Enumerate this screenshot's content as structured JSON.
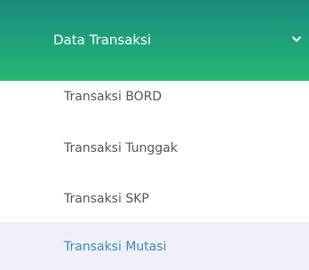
{
  "menu": {
    "header": {
      "label": "Data Transaksi",
      "icon": "chevron-down-icon",
      "colors": {
        "gradient_top": "#1a8a78",
        "gradient_bottom": "#27b86f",
        "text": "#ffffff"
      }
    },
    "items": [
      {
        "label": "Transaksi BORD",
        "active": false
      },
      {
        "label": "Transaksi Tunggak",
        "active": false
      },
      {
        "label": "Transaksi SKP",
        "active": false
      },
      {
        "label": "Transaksi Mutasi",
        "active": true
      }
    ],
    "colors": {
      "item_text": "#4f5562",
      "active_text": "#3a8fb7",
      "active_background": "#eeeff7"
    }
  }
}
